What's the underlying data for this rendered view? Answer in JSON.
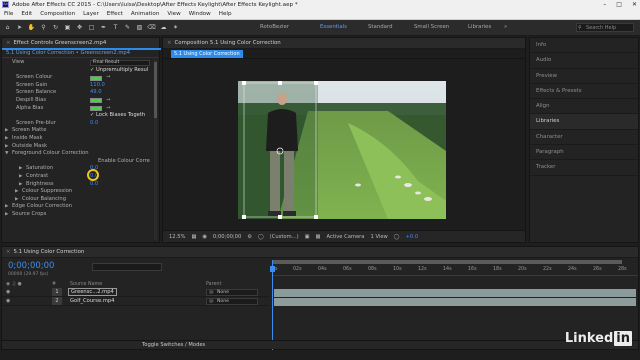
{
  "window": {
    "title": "Adobe After Effects CC 2015 - C:\\Users\\luisa\\Desktop\\After Effects Keylight\\After Effects Keylight.aep *"
  },
  "menu": [
    "File",
    "Edit",
    "Composition",
    "Layer",
    "Effect",
    "Animation",
    "View",
    "Window",
    "Help"
  ],
  "toolbar": {
    "rotobrush": "RotoBezier",
    "workspaces": [
      "Essentials",
      "Standard",
      "Small Screen",
      "Libraries"
    ],
    "active_workspace": "Essentials",
    "search_placeholder": "Search Help"
  },
  "effect_controls": {
    "tab": "Effect Controls  Greenscreen2.mp4",
    "subtitle": "5.1 Using Color Correction • Greenscreen2.mp4",
    "rows": [
      {
        "label": "View",
        "dropdown": "Final Result",
        "indent": 10
      },
      {
        "label": "✓ Unpremultiply Resul",
        "indent": 88,
        "check": true
      },
      {
        "label": "Screen Colour",
        "swatch": true,
        "indent": 14
      },
      {
        "label": "Screen Gain",
        "value": "110.0",
        "indent": 14
      },
      {
        "label": "Screen Balance",
        "value": "49.0",
        "indent": 14
      },
      {
        "label": "Despill Bias",
        "swatch": true,
        "indent": 14
      },
      {
        "label": "Alpha Bias",
        "swatch": true,
        "indent": 14
      },
      {
        "label": "✓ Lock Biases Togeth",
        "indent": 88,
        "check": true
      },
      {
        "label": "Screen Pre-blur",
        "value": "0.0",
        "indent": 14
      },
      {
        "label": "Screen Matte",
        "indent": 10,
        "tri": true
      },
      {
        "label": "Inside Mask",
        "indent": 10,
        "tri": true
      },
      {
        "label": "Outside Mask",
        "indent": 10,
        "tri": true
      },
      {
        "label": "Foreground Colour Correction",
        "indent": 10,
        "tri": true,
        "open": true
      },
      {
        "label": "Enable Colour Corre",
        "indent": 96
      },
      {
        "label": "Saturation",
        "value": "0.0",
        "indent": 24,
        "tri": true
      },
      {
        "label": "Contrast",
        "value": "0.0",
        "indent": 24,
        "tri": true
      },
      {
        "label": "Brightness",
        "value": "0.0",
        "indent": 24,
        "tri": true
      },
      {
        "label": "Colour Suppression",
        "indent": 20,
        "tri": true
      },
      {
        "label": "Colour Balancing",
        "indent": 20,
        "tri": true
      },
      {
        "label": "Edge Colour Correction",
        "indent": 10,
        "tri": true
      },
      {
        "label": "Source Crops",
        "indent": 10,
        "tri": true
      }
    ]
  },
  "composition": {
    "tab": "Composition  5.1 Using Color Correction",
    "chip": "5.1 Using Color Correction",
    "zoom": "12.5%",
    "timecode": "0;00;00;00",
    "resolution": "(Custom...)",
    "camera": "Active Camera",
    "views": "1 View",
    "offset": "+0.0"
  },
  "right_panels": [
    "Info",
    "Audio",
    "Preview",
    "Effects & Presets",
    "Align",
    "Libraries",
    "Character",
    "Paragraph",
    "Tracker"
  ],
  "right_panels_active": "Libraries",
  "timeline": {
    "tab": "5.1 Using Color Correction",
    "timecode": "0;00;00;00",
    "fps": "00000 (29.97 fps)",
    "col_source": "Source Name",
    "col_parent": "Parent",
    "ruler_ticks": [
      "0s",
      "02s",
      "04s",
      "06s",
      "08s",
      "10s",
      "12s",
      "14s",
      "16s",
      "18s",
      "20s",
      "22s",
      "24s",
      "26s",
      "28s"
    ],
    "layers": [
      {
        "num": "1",
        "name": "Greensc...2.mp4",
        "parent": "None"
      },
      {
        "num": "2",
        "name": "Golf_Course.mp4",
        "parent": "None"
      }
    ],
    "toggle_label": "Toggle Switches / Modes"
  },
  "watermark": {
    "left": "Linked",
    "right": "in"
  },
  "colors": {
    "accent": "#3c8df0",
    "swatch_green": "#3ed63e",
    "highlight": "#f0c419"
  }
}
